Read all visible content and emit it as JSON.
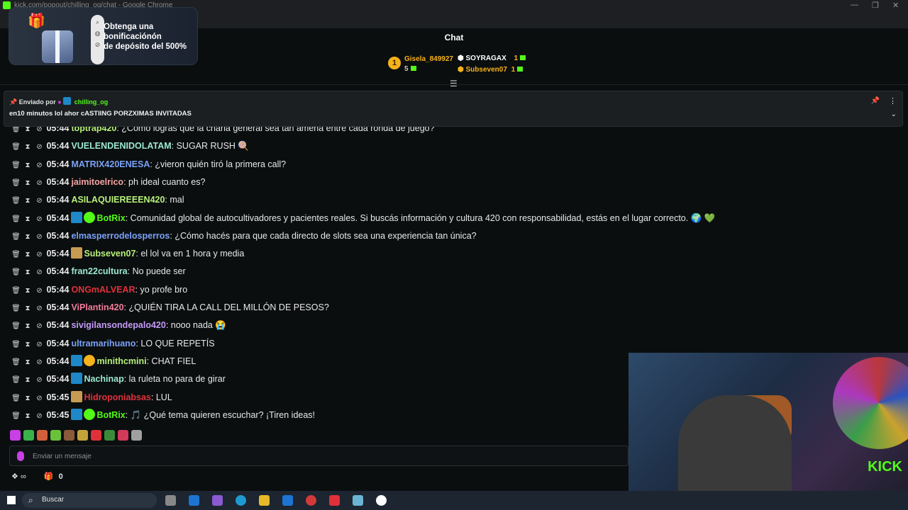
{
  "window": {
    "title": "kick.com/popout/chilling_og/chat - Google Chrome",
    "controls": [
      "—",
      "❐",
      "✕"
    ]
  },
  "promo": {
    "line1": "Obtenga una",
    "line2": "bonificaciónón",
    "line3": "de depósito del 500%"
  },
  "chat": {
    "title": "Chat",
    "leaderboard": [
      {
        "rank": "1",
        "name": "Gisela_849927",
        "count": "5",
        "color": "#f6b21b"
      },
      {
        "name": "SOYRAGAX",
        "count": "1",
        "color": "#ffffff"
      },
      {
        "name": "Subseven07",
        "count": "1",
        "color": "#f6b21b"
      }
    ]
  },
  "pinned": {
    "sent_by": "Enviado por",
    "user": "chilling_og",
    "message": "en10 minutos lol ahor cASTIING PORZXIMAS INVITADAS"
  },
  "messages": [
    {
      "time": "05:44",
      "user": "toptrap420",
      "color": "#b7f07a",
      "badges": [],
      "text": "¿Cómo logras que la charla general sea tan amena entre cada ronda de juego?"
    },
    {
      "time": "05:44",
      "user": "VUELENDENIDOLATAM",
      "color": "#9be8d0",
      "badges": [],
      "text": "SUGAR RUSH 🍭"
    },
    {
      "time": "05:44",
      "user": "MATRIX420ENESA",
      "color": "#7aa2f7",
      "badges": [],
      "text": "¿vieron quién tiró la primera call?"
    },
    {
      "time": "05:44",
      "user": "jaimitoelrico",
      "color": "#f7a3a3",
      "badges": [],
      "text": "ph ideal cuanto es?"
    },
    {
      "time": "05:44",
      "user": "ASILAQUIEREEEN420",
      "color": "#b7f07a",
      "badges": [],
      "text": "mal"
    },
    {
      "time": "05:44",
      "user": "BotRix",
      "color": "#53fc18",
      "badges": [
        "b-blue",
        "b-green"
      ],
      "text": "Comunidad global de autocultivadores y pacientes reales. Si buscás información y cultura 420 con responsabilidad, estás en el lugar correcto. 🌍 💚"
    },
    {
      "time": "05:44",
      "user": "elmasperrodelosperros",
      "color": "#7aa2f7",
      "badges": [],
      "text": "¿Cómo hacés para que cada directo de slots sea una experiencia tan única?"
    },
    {
      "time": "05:44",
      "user": "Subseven07",
      "color": "#b7f07a",
      "badges": [
        "b-sub"
      ],
      "text": "el lol va en 1 hora y media"
    },
    {
      "time": "05:44",
      "user": "fran22cultura",
      "color": "#9be8d0",
      "badges": [],
      "text": "No puede ser"
    },
    {
      "time": "05:44",
      "user": "ONGmALVEAR",
      "color": "#e0313a",
      "badges": [],
      "text": "yo profe bro"
    },
    {
      "time": "05:44",
      "user": "ViPlantin420",
      "color": "#f27b9a",
      "badges": [],
      "text": "¿QUIÉN TIRA LA CALL DEL MILLÓN DE PESOS?"
    },
    {
      "time": "05:44",
      "user": "sivigilansondepalo420",
      "color": "#c39cf7",
      "badges": [],
      "text": "nooo nada 😭"
    },
    {
      "time": "05:44",
      "user": "ultramarihuano",
      "color": "#7aa2f7",
      "badges": [],
      "text": "LO QUE REPETÍS"
    },
    {
      "time": "05:44",
      "user": "minithcmini",
      "color": "#b7f07a",
      "badges": [
        "b-blue",
        "b-gold"
      ],
      "text": "CHAT FIEL"
    },
    {
      "time": "05:44",
      "user": "Nachinap",
      "color": "#9be8d0",
      "badges": [
        "b-blue"
      ],
      "text": "la ruleta no para de girar"
    },
    {
      "time": "05:45",
      "user": "Hidroponiabsas",
      "color": "#e0313a",
      "badges": [
        "b-sub"
      ],
      "text": "LUL"
    },
    {
      "time": "05:45",
      "user": "BotRix",
      "color": "#53fc18",
      "badges": [
        "b-blue",
        "b-green"
      ],
      "text": "🎵 ¿Qué tema quieren escuchar? ¡Tiren ideas!"
    }
  ],
  "emote_colors": [
    "#c940e6",
    "#3ab24a",
    "#d2603a",
    "#6ac23a",
    "#8a5a3a",
    "#c2a23a",
    "#e0313a",
    "#3a8a3a",
    "#d23a5a",
    "#a0a0a0"
  ],
  "input": {
    "placeholder": "Enviar un mensaje"
  },
  "footer": {
    "infinite": "∞",
    "count": "0"
  },
  "video": {
    "brand": "KICK"
  },
  "taskbar": {
    "search_label": "Buscar"
  }
}
